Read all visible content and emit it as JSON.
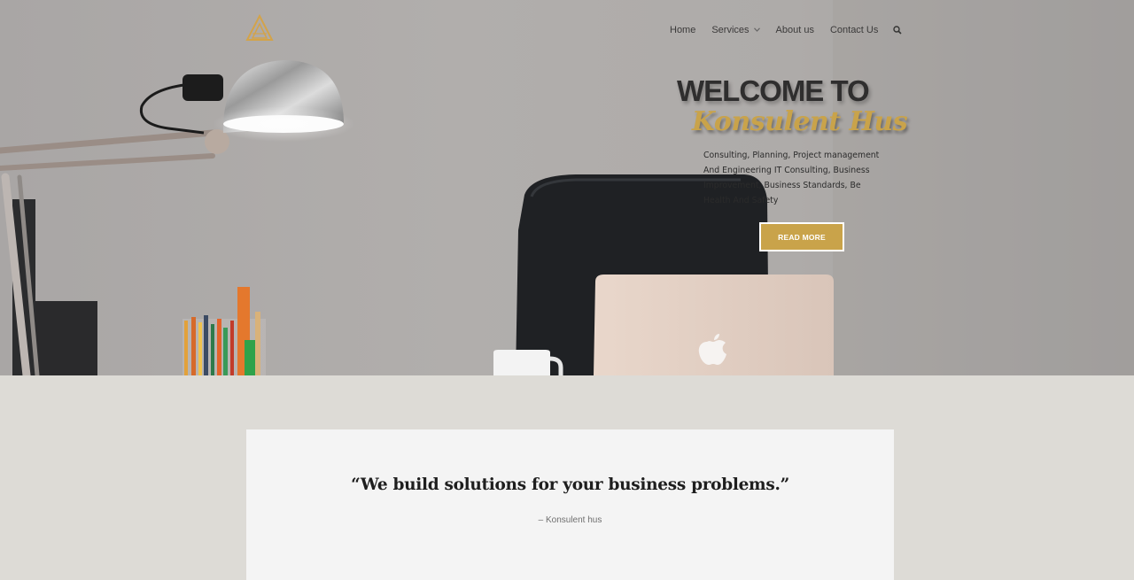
{
  "nav": {
    "items": [
      {
        "label": "Home"
      },
      {
        "label": "Services"
      },
      {
        "label": "About us"
      },
      {
        "label": "Contact Us"
      }
    ]
  },
  "hero": {
    "title": "WELCOME TO",
    "brand": "Konsulent Hus",
    "description": "Consulting, Planning, Project management And Engineering IT Consulting, Business Improvement, Business Standards, Be Health And Safety",
    "cta_label": "READ MORE"
  },
  "testimonial": {
    "quote": "“We build solutions for your business problems.”",
    "author": "– Konsulent hus"
  },
  "colors": {
    "accent": "#c9a34a",
    "nav_text": "#3b3a3a",
    "section_bg": "#dddbd6",
    "card_bg": "#f4f4f4"
  },
  "icons": [
    "logo-icon",
    "chevron-down-icon",
    "search-icon"
  ]
}
